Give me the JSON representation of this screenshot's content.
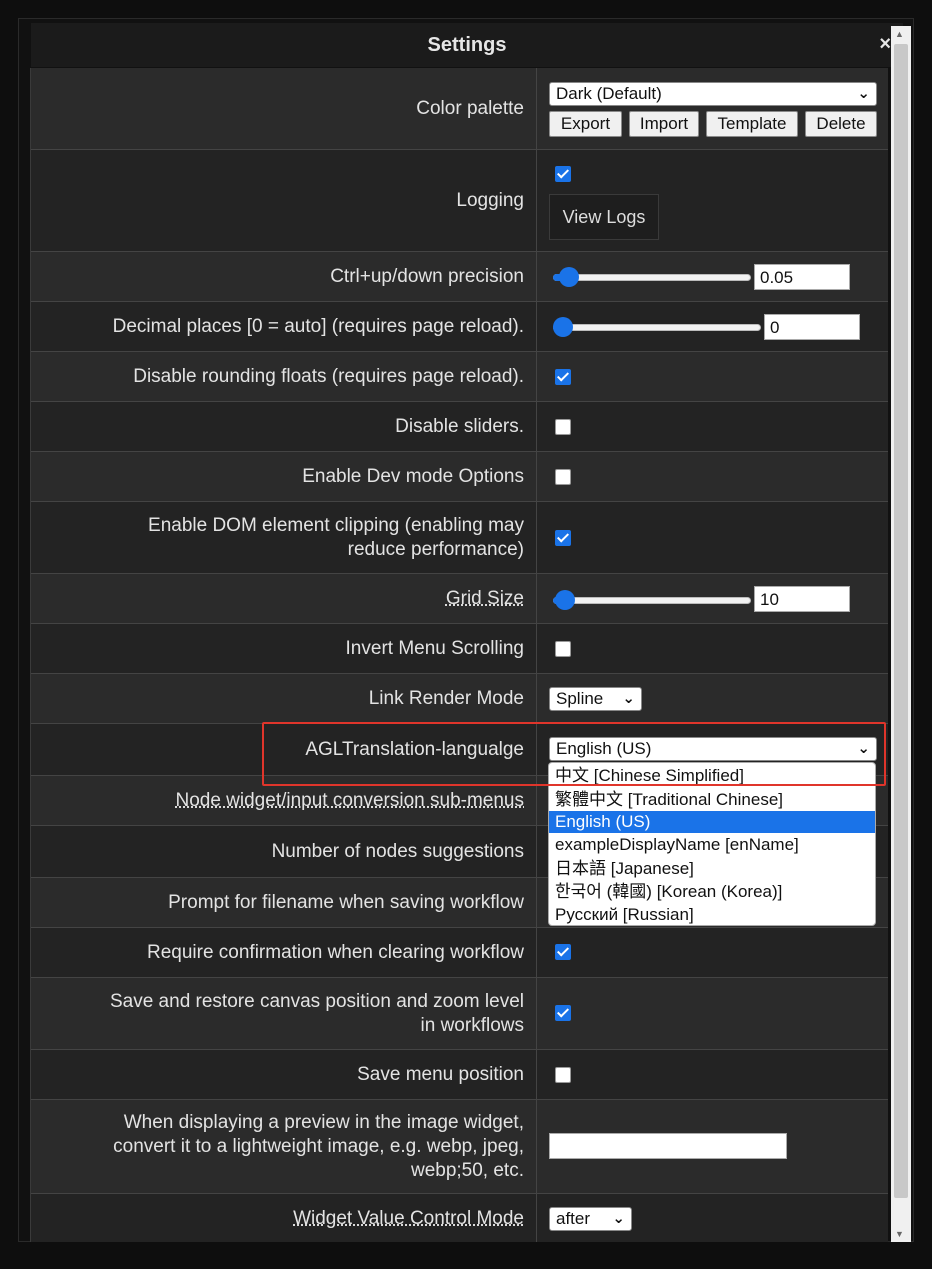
{
  "dialog": {
    "title": "Settings",
    "close_symbol": "×"
  },
  "rows": {
    "color_palette": {
      "label": "Color palette",
      "selected": "Dark (Default)",
      "buttons": [
        "Export",
        "Import",
        "Template",
        "Delete"
      ]
    },
    "logging": {
      "label": "Logging",
      "checked": true,
      "button": "View Logs"
    },
    "ctrl_precision": {
      "label": "Ctrl+up/down precision",
      "value": "0.05",
      "slider_fraction": 0.05
    },
    "decimal_places": {
      "label": "Decimal places [0 = auto] (requires page reload).",
      "value": "0",
      "slider_fraction": 0.0
    },
    "disable_rounding": {
      "label": "Disable rounding floats (requires page reload).",
      "checked": true
    },
    "disable_sliders": {
      "label": "Disable sliders.",
      "checked": false
    },
    "dev_mode": {
      "label": "Enable Dev mode Options",
      "checked": false
    },
    "dom_clipping": {
      "label_line1": "Enable DOM element clipping (enabling may",
      "label_line2": "reduce performance)",
      "checked": true
    },
    "grid_size": {
      "label": "Grid Size",
      "value": "10",
      "slider_fraction": 0.05
    },
    "invert_menu": {
      "label": "Invert Menu Scrolling",
      "checked": false
    },
    "link_render": {
      "label": "Link Render Mode",
      "selected": "Spline"
    },
    "agl_translation": {
      "label": "AGLTranslation-langualge",
      "selected": "English (US)",
      "options": [
        "中文 [Chinese Simplified]",
        "繁體中文 [Traditional Chinese]",
        "English (US)",
        "exampleDisplayName [enName]",
        "日本語 [Japanese]",
        "한국어 (韓國) [Korean (Korea)]",
        "Русский [Russian]"
      ],
      "highlighted_index": 2
    },
    "node_widget": {
      "label": "Node widget/input conversion sub-menus"
    },
    "node_suggestions": {
      "label": "Number of nodes suggestions"
    },
    "prompt_filename": {
      "label": "Prompt for filename when saving workflow"
    },
    "require_confirm": {
      "label": "Require confirmation when clearing workflow",
      "checked": true
    },
    "save_canvas": {
      "label_line1": "Save and restore canvas position and zoom level",
      "label_line2": "in workflows",
      "checked": true
    },
    "save_menu": {
      "label": "Save menu position",
      "checked": false
    },
    "preview": {
      "label_line1": "When displaying a preview in the image widget,",
      "label_line2": "convert it to a lightweight image, e.g. webp, jpeg,",
      "label_line3": "webp;50, etc.",
      "value": ""
    },
    "widget_control": {
      "label": "Widget Value Control Mode",
      "selected": "after"
    }
  },
  "icons": {
    "chevron": "chevron-down-icon",
    "checkbox_check": "check-icon"
  },
  "colors": {
    "accent": "#1a73e8",
    "highlight_box": "#e0352b",
    "row_a": "#2b2b2b",
    "row_b": "#232323"
  }
}
